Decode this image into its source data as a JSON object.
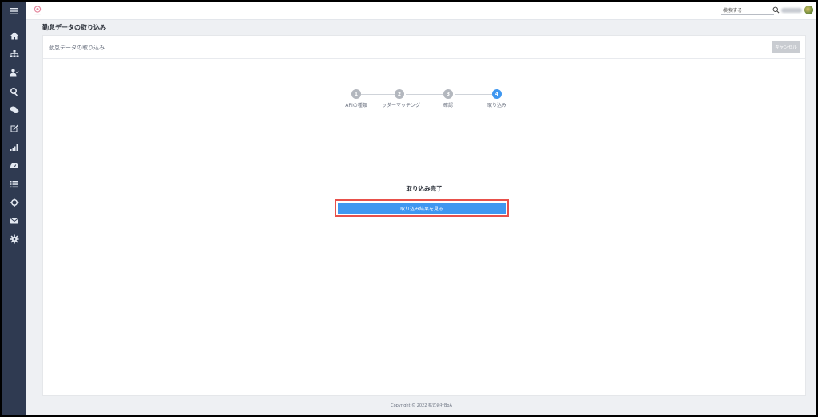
{
  "header": {
    "search_placeholder": "検索する"
  },
  "page": {
    "title": "勤怠データの取り込み"
  },
  "panel": {
    "title": "勤怠データの取り込み",
    "cancel_label": "キャンセル"
  },
  "stepper": {
    "steps": [
      {
        "number": "1",
        "label": "APIの種類"
      },
      {
        "number": "2",
        "label": "ッダーマッチング"
      },
      {
        "number": "3",
        "label": "確認"
      },
      {
        "number": "4",
        "label": "取り込み"
      }
    ],
    "active_step": 4
  },
  "result": {
    "complete_text": "取り込み完了",
    "view_results_label": "取り込み結果を見る"
  },
  "footer": {
    "copyright": "Copyright © 2022 株式会社BoA"
  },
  "colors": {
    "sidebar": "#2f3a51",
    "accent": "#3f97f0",
    "highlight": "#e8504a"
  }
}
